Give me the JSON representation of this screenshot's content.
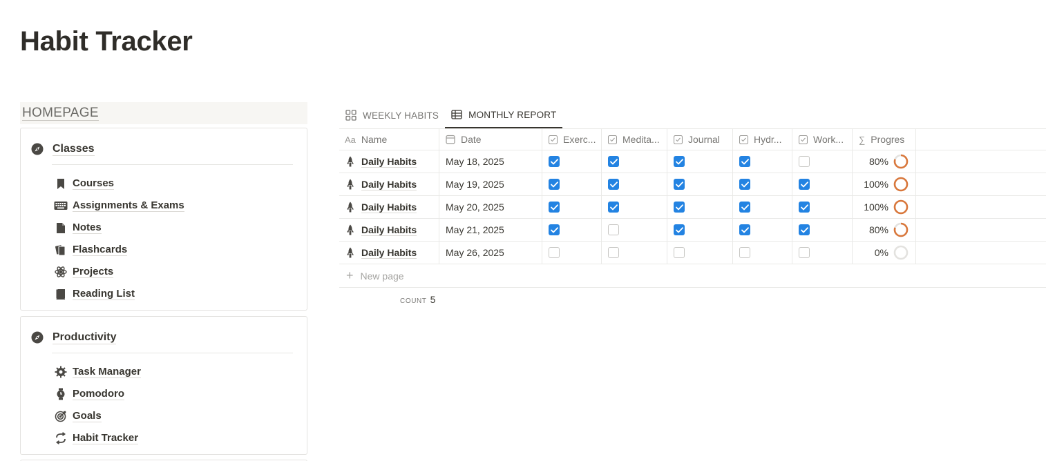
{
  "page": {
    "title": "Habit Tracker"
  },
  "sidebar": {
    "homepage_label": "HOMEPAGE",
    "sections": [
      {
        "title": "Classes",
        "icon": "compass-icon",
        "items": [
          {
            "label": "Courses",
            "icon": "bookmark-icon"
          },
          {
            "label": "Assignments & Exams",
            "icon": "keyboard-icon"
          },
          {
            "label": "Notes",
            "icon": "document-icon"
          },
          {
            "label": "Flashcards",
            "icon": "cards-icon"
          },
          {
            "label": "Projects",
            "icon": "atom-icon"
          },
          {
            "label": "Reading List",
            "icon": "book-icon"
          }
        ]
      },
      {
        "title": "Productivity",
        "icon": "compass-icon",
        "items": [
          {
            "label": "Task Manager",
            "icon": "gear-icon"
          },
          {
            "label": "Pomodoro",
            "icon": "stopwatch-icon"
          },
          {
            "label": "Goals",
            "icon": "target-icon"
          },
          {
            "label": "Habit Tracker",
            "icon": "repeat-icon"
          }
        ]
      }
    ]
  },
  "tabs": [
    {
      "label": "WEEKLY HABITS",
      "icon": "gallery-icon",
      "active": false
    },
    {
      "label": "MONTHLY REPORT",
      "icon": "table-icon",
      "active": true
    }
  ],
  "table": {
    "columns": {
      "name": "Name",
      "date": "Date",
      "exercise": "Exerc...",
      "meditation": "Medita...",
      "journal": "Journal",
      "hydration": "Hydr...",
      "workout": "Work...",
      "progress": "Progres"
    },
    "name_type_glyph": "Aa",
    "formula_glyph": "∑",
    "rows": [
      {
        "name": "Daily Habits",
        "date": "May 18, 2025",
        "checks": [
          true,
          true,
          true,
          true,
          false
        ],
        "progress_label": "80%",
        "progress": 0.8
      },
      {
        "name": "Daily Habits",
        "date": "May 19, 2025",
        "checks": [
          true,
          true,
          true,
          true,
          true
        ],
        "progress_label": "100%",
        "progress": 1.0
      },
      {
        "name": "Daily Habits",
        "date": "May 20, 2025",
        "checks": [
          true,
          true,
          true,
          true,
          true
        ],
        "progress_label": "100%",
        "progress": 1.0
      },
      {
        "name": "Daily Habits",
        "date": "May 21, 2025",
        "checks": [
          true,
          false,
          true,
          true,
          true
        ],
        "progress_label": "80%",
        "progress": 0.8
      },
      {
        "name": "Daily Habits",
        "date": "May 26, 2025",
        "checks": [
          false,
          false,
          false,
          false,
          false
        ],
        "progress_label": "0%",
        "progress": 0.0
      }
    ],
    "new_page_label": "New page",
    "count_label": "COUNT",
    "count_value": "5"
  },
  "colors": {
    "checkbox_on": "#2383e2",
    "progress_ring": "#d9773b",
    "progress_track": "#e3e2df",
    "text": "#37352f"
  }
}
